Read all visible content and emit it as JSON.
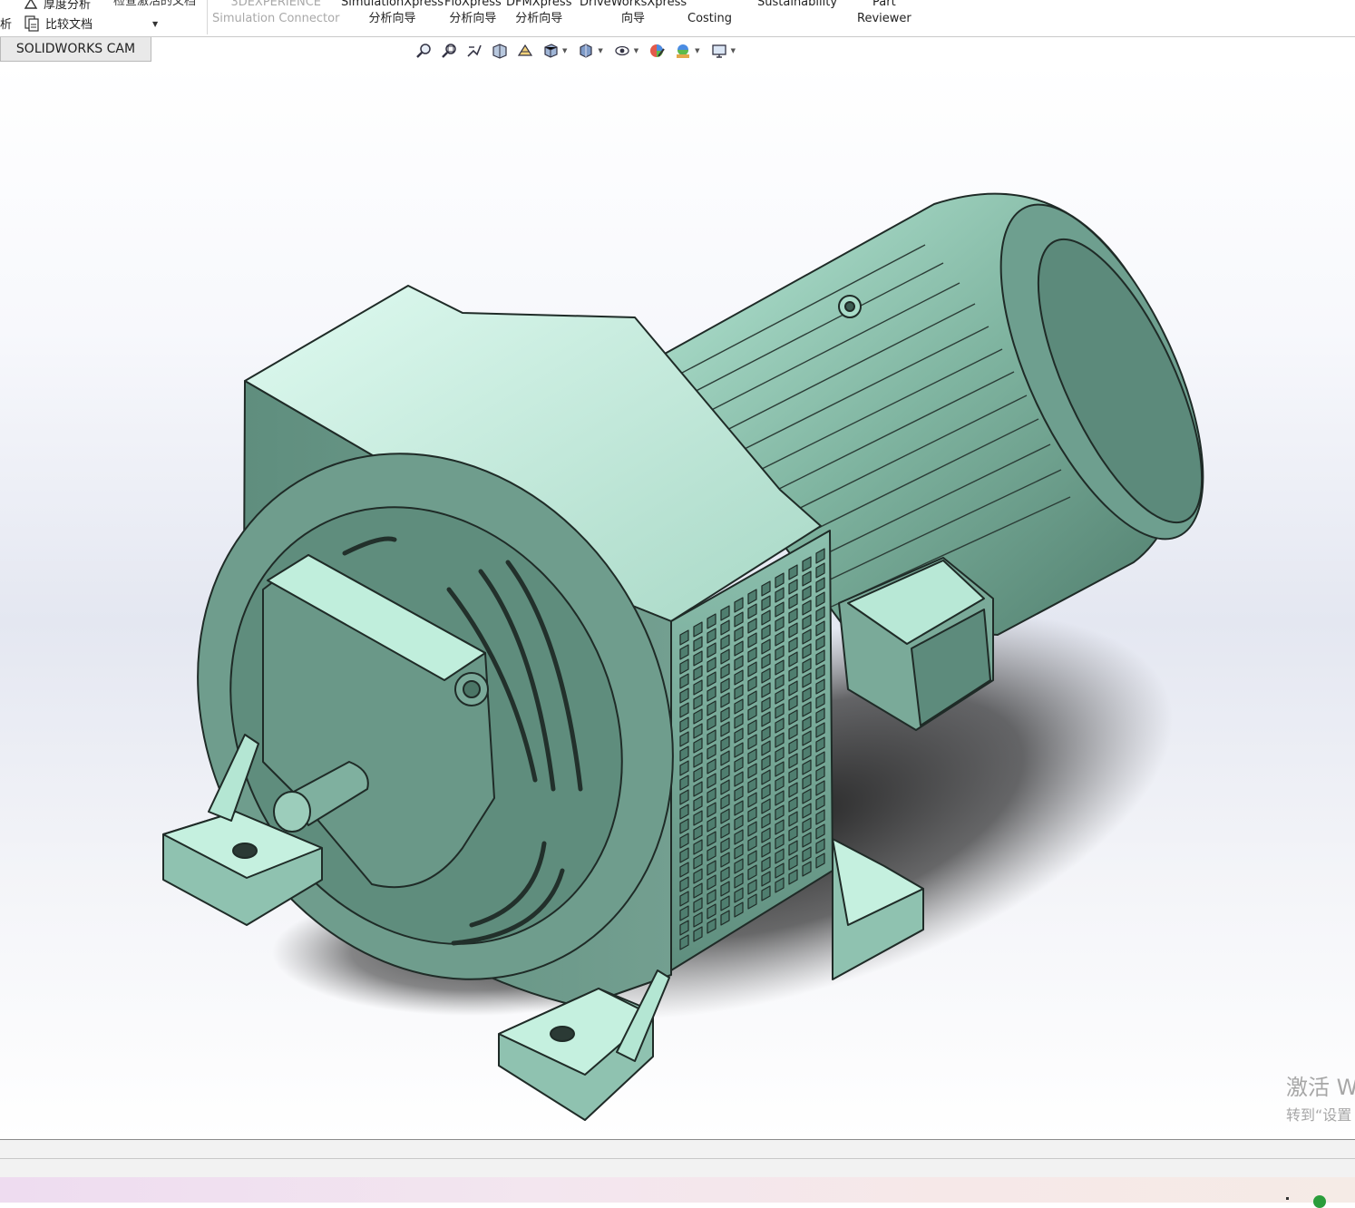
{
  "ribbon": {
    "left_items": [
      {
        "label": "厚度分析",
        "icon": "thickness-analysis-icon"
      },
      {
        "label": "比较文档",
        "icon": "compare-documents-icon"
      }
    ],
    "left_cut_label": "析",
    "truncated_top_label": "检查激活的文档",
    "buttons": [
      {
        "line1": "3DEXPERIENCE",
        "line2": "Simulation Connector",
        "disabled": true
      },
      {
        "line1": "SimulationXpress",
        "line2": "分析向导",
        "disabled": false
      },
      {
        "line1": "FloXpress",
        "line2": "分析向导",
        "disabled": false
      },
      {
        "line1": "DFMXpress",
        "line2": "分析向导",
        "disabled": false
      },
      {
        "line1": "DriveWorksXpress",
        "line2": "向导",
        "disabled": false
      },
      {
        "line1": "",
        "line2": "Costing",
        "disabled": false
      },
      {
        "line1": "Sustainability",
        "line2": "",
        "disabled": false
      },
      {
        "line1": "Part",
        "line2": "Reviewer",
        "disabled": false
      }
    ]
  },
  "tabs": {
    "active": "SOLIDWORKS CAM"
  },
  "heads_up_toolbar": {
    "icons": [
      "zoom-to-fit-icon",
      "zoom-to-area-icon",
      "previous-view-icon",
      "section-view-icon",
      "dynamic-annotation-views-icon",
      "view-orientation-icon",
      "display-style-icon",
      "hide-show-items-icon",
      "edit-appearance-icon",
      "apply-scene-icon",
      "view-settings-icon"
    ]
  },
  "viewport": {
    "model_name": "gear motor",
    "model_color": "#6a9a8a",
    "highlight_color": "#c8f0de"
  },
  "watermark": {
    "line1": "激活 W",
    "line2": "转到“设置"
  }
}
